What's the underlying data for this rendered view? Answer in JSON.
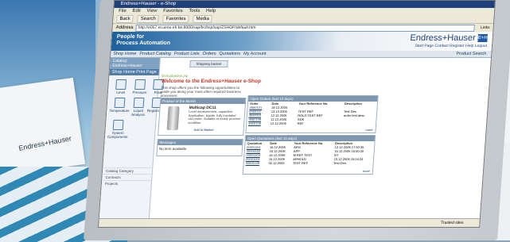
{
  "browser": {
    "title": "Endress+Hauser - e-Shop",
    "menu": [
      "File",
      "Edit",
      "View",
      "Favorites",
      "Tools",
      "Help"
    ],
    "toolbar": [
      "Back",
      "Search",
      "Favorites",
      "Media"
    ],
    "address_label": "Address",
    "address_value": "http://e057.et.ueno.eh.be:8000/sap/bc/bsp/sap/ZSHOP/default.htm",
    "links_label": "Links",
    "status": "Trusted sites"
  },
  "site": {
    "tagline_1": "People for",
    "tagline_2": "Process Automation",
    "logo_text": "Endress+Hauser",
    "logo_mark": "E+H",
    "top_links": "Start Page  Contact  Register  Help  Logout",
    "product_search": "Product Search",
    "nav": [
      "Shop Home",
      "Product Catalog",
      "Product Lists",
      "Orders",
      "Quotations",
      "My Account"
    ],
    "sidebar_head": "Catalog: Endress+Hauser",
    "sidebar_title": "Shop Home",
    "sidebar_title_right": "Print Page",
    "products": [
      "Level",
      "Pressure",
      "Flow",
      "Temperature",
      "Liquid Analysis",
      "Registration",
      "System Components"
    ],
    "side_links": [
      "Catalog Category",
      "Contracts",
      "Projects"
    ],
    "shipping_button": "Shipping basket",
    "crumb": "Eshopbasket.jsp",
    "welcome": "Welcome to the Endress+Hauser e-Shop",
    "intro": "This shop offers you the following opportunities to guide you along your most often required business processes:",
    "pom_header": "Product of the Month",
    "pom_name": "Multicap DC11",
    "pom_desc": "Level measurement, capacitive. Application: liquids, fully insulated rod probe. Suitable at nearly process condition.",
    "pom_link": "Add to Basket",
    "msg_header": "Messages",
    "msg_text": "No item available",
    "orders_header": "Open Orders (last 10 days)",
    "orders_cols": [
      "Order",
      "Date",
      "Your Reference No.",
      "Description"
    ],
    "orders": [
      [
        "4560121",
        "19.12.2005",
        "",
        ""
      ],
      [
        "4560111",
        "13.12.2005",
        "TEST REF",
        "Test Des."
      ],
      [
        "4560110",
        "12.12.2005",
        "ROLD TEST REF",
        "order test desc"
      ],
      [
        "4560109",
        "12.12.2005",
        "SDK",
        ""
      ],
      [
        "4560108",
        "12.12.2005",
        "REF",
        ""
      ]
    ],
    "quots_header": "Open Quotations (last 10 days)",
    "quots_cols": [
      "Quotation",
      "Date",
      "Your Reference No.",
      "Description"
    ],
    "quots": [
      [
        "00001101",
        "16.12.2005",
        "ARG",
        "12.12.2005 17:50:35"
      ],
      [
        "00001102",
        "16.12.2005",
        "APP",
        "16.12.2005 16:50:40"
      ],
      [
        "00001103",
        "16.12.2005",
        "M REF TEST",
        "NT"
      ],
      [
        "00001104",
        "15.12.2005",
        "ARHOLD",
        "13.12.2005 15:04:24"
      ],
      [
        "00001105",
        "02.12.2005",
        "TEST REF",
        "Test Des."
      ]
    ],
    "more": "more"
  },
  "scene": {
    "brochure_logo": "Endress+Hauser"
  }
}
